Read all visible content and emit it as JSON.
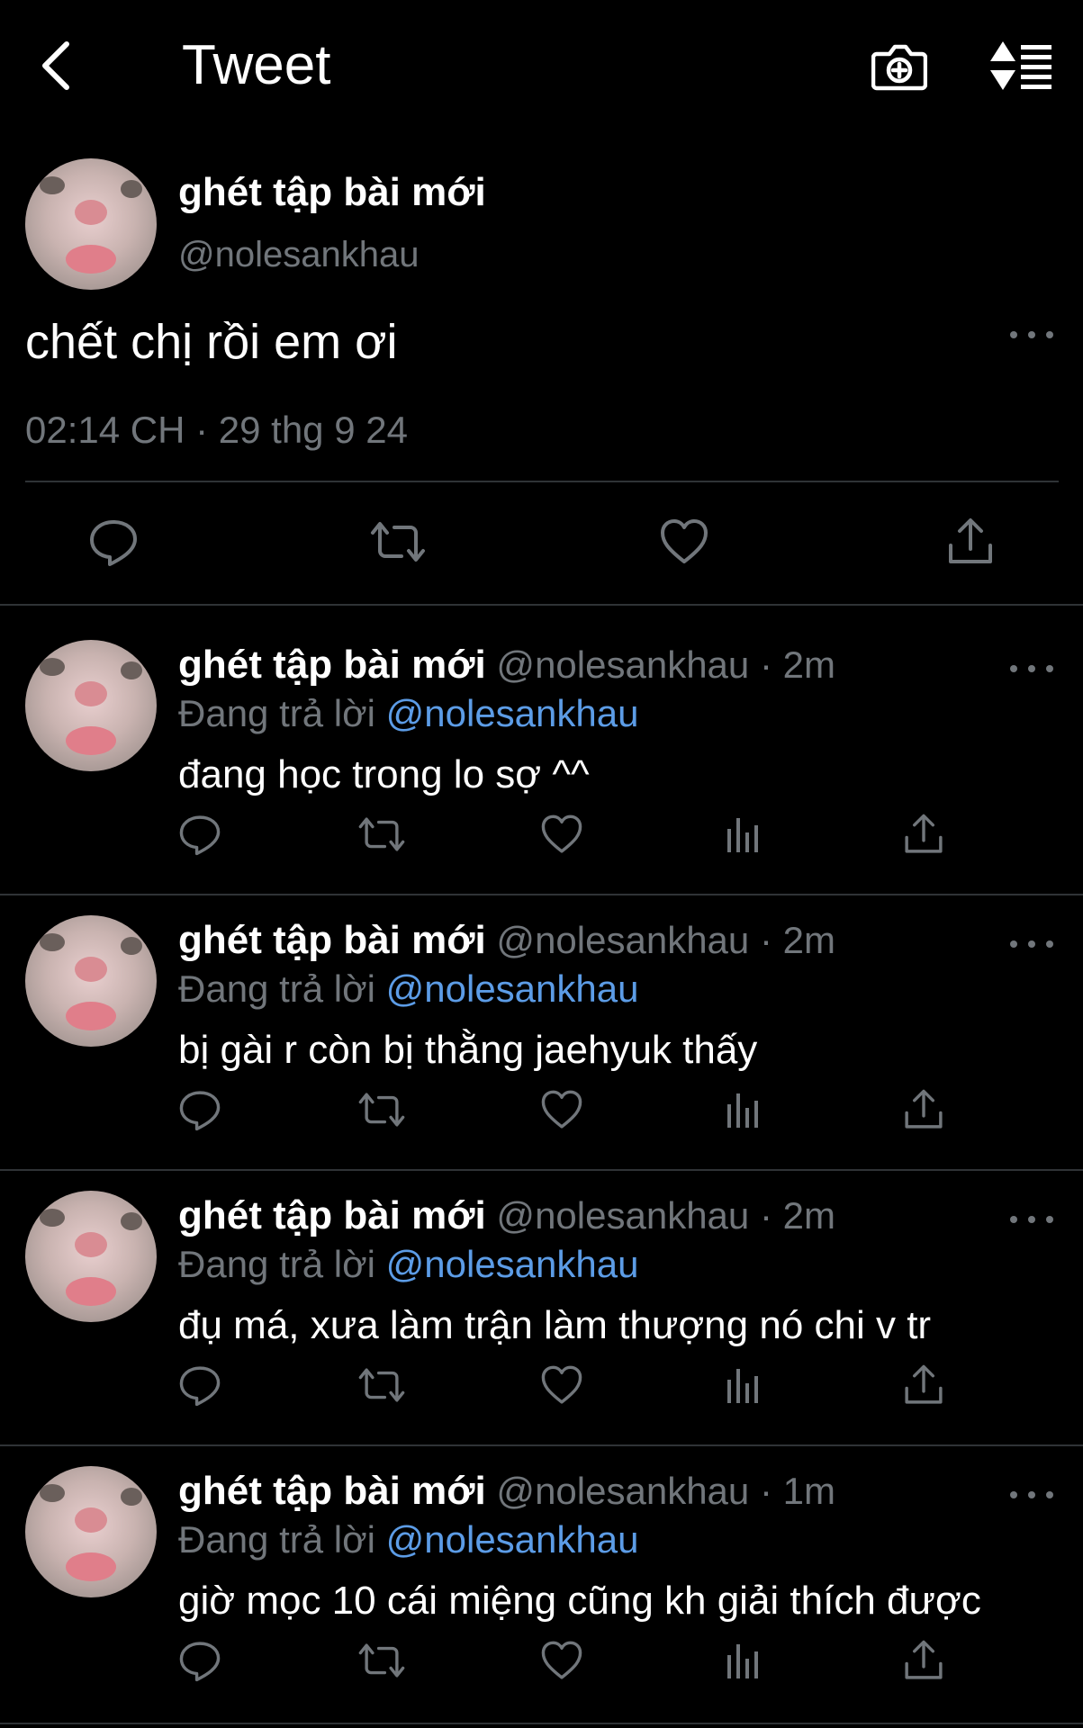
{
  "header": {
    "back_icon": "chevron-left-icon",
    "title": "Tweet",
    "camera_icon": "camera-add-icon",
    "sort_icon": "sort-list-icon"
  },
  "main_tweet": {
    "name": "ghét tập bài mới",
    "handle": "@nolesankhau",
    "text": "chết chị rồi em ơi",
    "timestamp": "02:14 CH · 29 thg 9 24",
    "actions": [
      "reply-icon",
      "retweet-icon",
      "like-icon",
      "share-icon"
    ]
  },
  "replies": [
    {
      "name": "ghét tập bài mới",
      "meta": " @nolesankhau · 2m",
      "replying_label": "Đang trả lời ",
      "replying_to": "@nolesankhau",
      "text": "đang học trong lo sợ ^^"
    },
    {
      "name": "ghét tập bài mới",
      "meta": " @nolesankhau · 2m",
      "replying_label": "Đang trả lời ",
      "replying_to": "@nolesankhau",
      "text": "bị gài r còn bị thằng jaehyuk thấy"
    },
    {
      "name": "ghét tập bài mới",
      "meta": " @nolesankhau · 2m",
      "replying_label": "Đang trả lời ",
      "replying_to": "@nolesankhau",
      "text": "đụ má, xưa làm trận làm thượng nó chi v tr"
    },
    {
      "name": "ghét tập bài mới",
      "meta": " @nolesankhau · 1m",
      "replying_label": "Đang trả lời ",
      "replying_to": "@nolesankhau",
      "text": "giờ mọc 10 cái miệng cũng kh giải thích được"
    }
  ],
  "colors": {
    "background": "#000000",
    "text": "#ffffff",
    "secondary": "#71767b",
    "mention": "#5c9ce6",
    "divider": "#2f3336"
  }
}
